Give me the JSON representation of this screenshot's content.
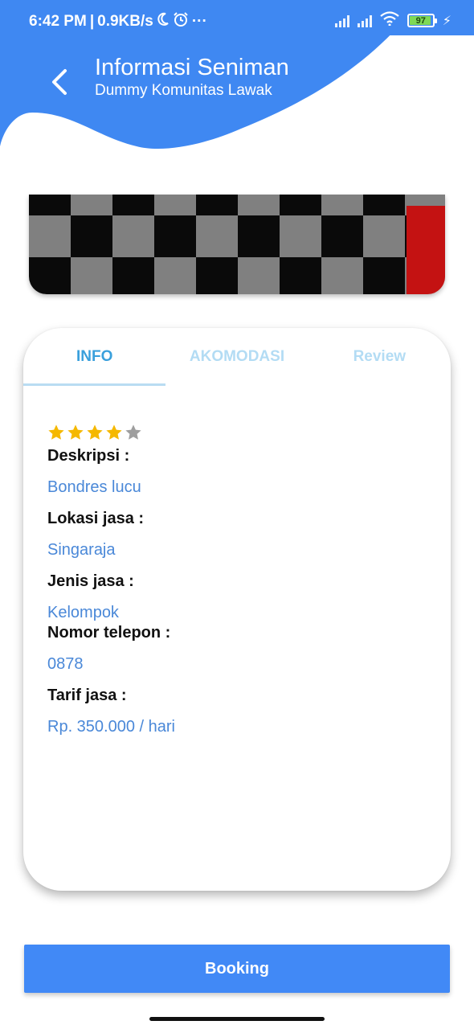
{
  "status_bar": {
    "time": "6:42 PM",
    "separator": "|",
    "network_speed": "0.9KB/s",
    "moon_icon": "moon-icon",
    "alarm_icon": "alarm-icon",
    "more": "···",
    "battery_level": "97"
  },
  "header": {
    "back_icon": "chevron-left-icon",
    "title": "Informasi Seniman",
    "subtitle": "Dummy Komunitas Lawak",
    "color": "#3f88f2"
  },
  "tabs": [
    {
      "label": "INFO",
      "active": true
    },
    {
      "label": "AKOMODASI",
      "active": false
    },
    {
      "label": "Review",
      "active": false
    }
  ],
  "rating": {
    "value": 4,
    "max": 5
  },
  "info": {
    "description_label": "Deskripsi :",
    "description_value": "Bondres lucu",
    "location_label": "Lokasi jasa :",
    "location_value": "Singaraja",
    "type_label": "Jenis jasa :",
    "type_value": "Kelompok",
    "phone_label": "Nomor telepon :",
    "phone_value": "0878",
    "rate_label": "Tarif jasa :",
    "rate_value": "Rp. 350.000 / hari"
  },
  "booking_button": {
    "label": "Booking",
    "color": "#4189f6"
  },
  "colors": {
    "accent": "#3f88f2",
    "tab_active": "#3aa0dc",
    "tab_inactive": "#b3dcf4",
    "value_text": "#4a88d8",
    "star_filled": "#f5b800",
    "star_empty": "#9e9e9e"
  }
}
